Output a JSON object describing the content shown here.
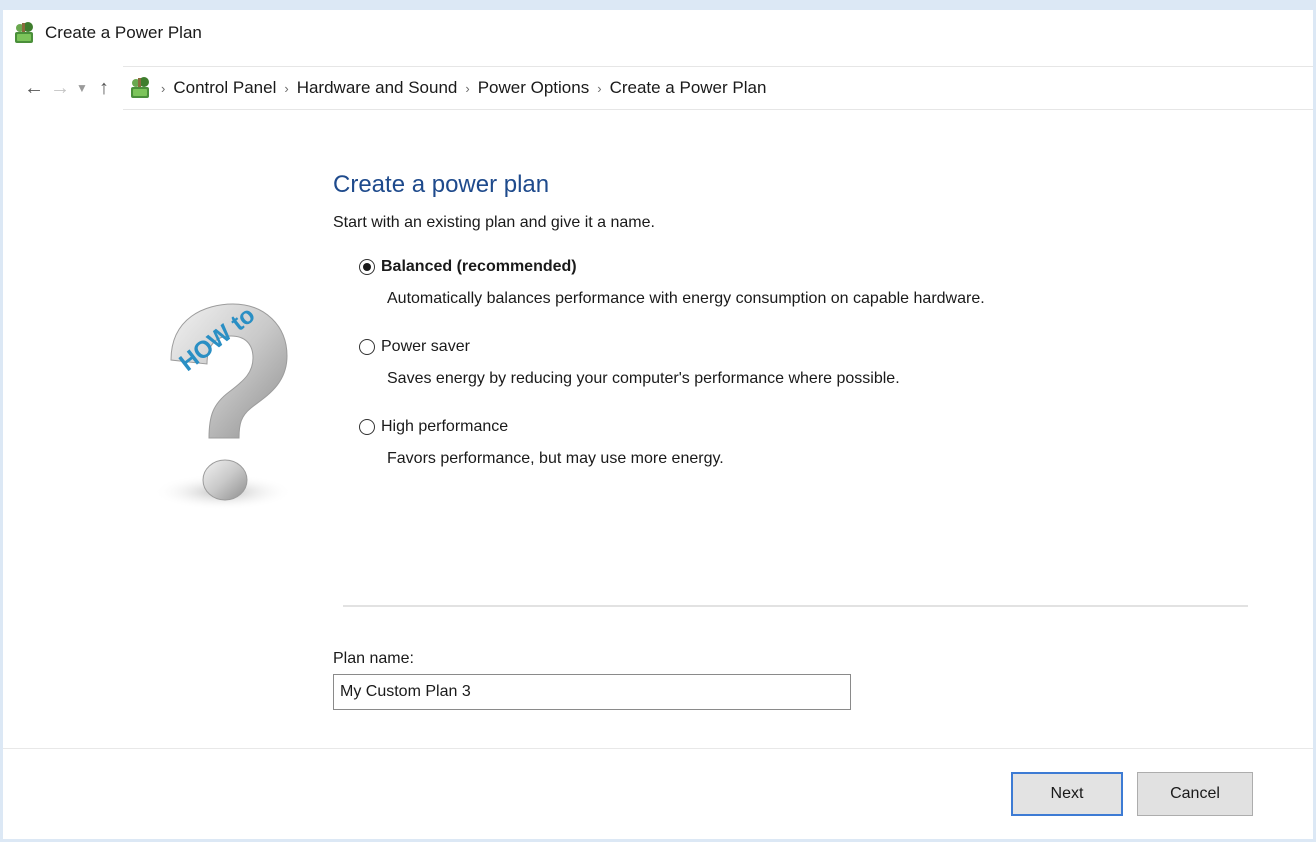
{
  "window": {
    "title": "Create a Power Plan"
  },
  "nav": {
    "breadcrumbs": [
      {
        "label": "Control Panel"
      },
      {
        "label": "Hardware and Sound"
      },
      {
        "label": "Power Options"
      },
      {
        "label": "Create a Power Plan"
      }
    ]
  },
  "illustration": {
    "icon": "help-question-icon",
    "text": "HOW to",
    "colors": {
      "question": "#c9c9c9",
      "text": "#2a8fc4"
    }
  },
  "main": {
    "title": "Create a power plan",
    "subtitle": "Start with an existing plan and give it a name.",
    "plans": [
      {
        "label": "Balanced (recommended)",
        "description": "Automatically balances performance with energy consumption on capable hardware.",
        "selected": true
      },
      {
        "label": "Power saver",
        "description": "Saves energy by reducing your computer's performance where possible.",
        "selected": false
      },
      {
        "label": "High performance",
        "description": "Favors performance, but may use more energy.",
        "selected": false
      }
    ],
    "plan_name": {
      "label": "Plan name:",
      "value": "My Custom Plan 3"
    }
  },
  "footer": {
    "next_label": "Next",
    "cancel_label": "Cancel"
  },
  "colors": {
    "title": "#1e4a8c",
    "focus_border": "#3d7bd4",
    "chrome": "#dce8f5"
  }
}
